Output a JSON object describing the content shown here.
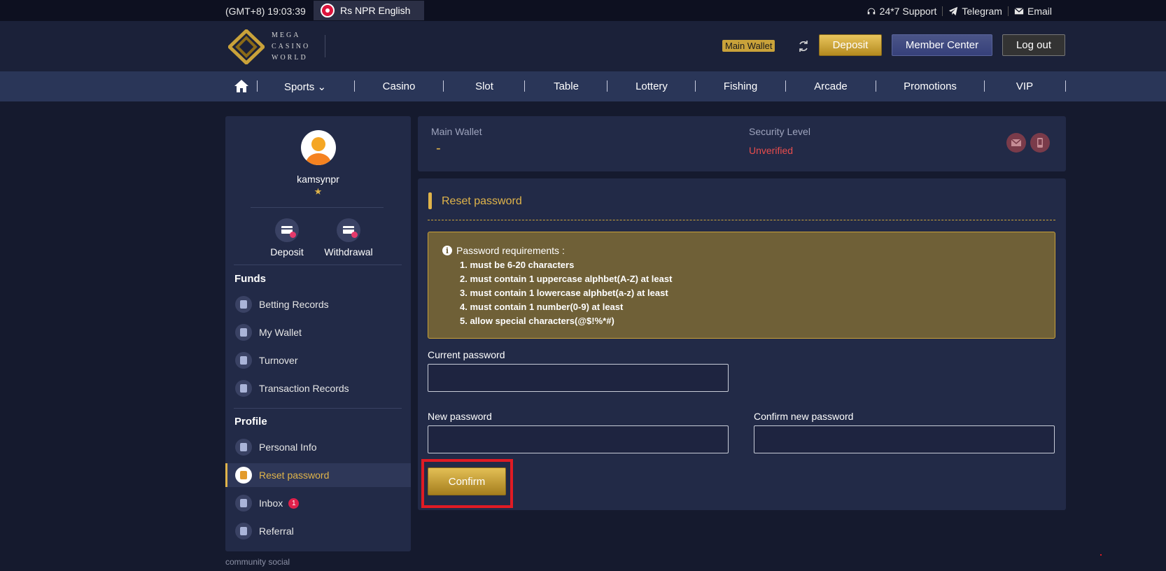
{
  "topbar": {
    "time": "(GMT+8) 19:03:39",
    "language": "Rs NPR English",
    "links": [
      {
        "label": "24*7 Support",
        "icon": "headset-icon"
      },
      {
        "label": "Telegram",
        "icon": "telegram-icon"
      },
      {
        "label": "Email",
        "icon": "email-icon"
      }
    ]
  },
  "header": {
    "logo_lines": [
      "MEGA",
      "CASINO",
      "WORLD"
    ],
    "wallet_badge": "Main Wallet",
    "deposit_label": "Deposit",
    "member_center_label": "Member Center",
    "logout_label": "Log out"
  },
  "nav": {
    "items": [
      "Sports",
      "Casino",
      "Slot",
      "Table",
      "Lottery",
      "Fishing",
      "Arcade",
      "Promotions",
      "VIP"
    ]
  },
  "sidebar": {
    "username": "kamsynpr",
    "star": "★",
    "quick": [
      {
        "label": "Deposit",
        "icon": "deposit-icon"
      },
      {
        "label": "Withdrawal",
        "icon": "withdrawal-icon"
      }
    ],
    "funds_title": "Funds",
    "funds_items": [
      "Betting Records",
      "My Wallet",
      "Turnover",
      "Transaction Records"
    ],
    "profile_title": "Profile",
    "profile_items": [
      "Personal Info",
      "Reset password",
      "Inbox",
      "Referral"
    ],
    "inbox_badge": "1",
    "footer": "community social"
  },
  "wallet": {
    "main_wallet_label": "Main Wallet",
    "main_wallet_value": "-",
    "security_label": "Security Level",
    "security_value": "Unverified"
  },
  "reset": {
    "title": "Reset password",
    "requirements_title": "Password requirements :",
    "requirements": [
      "1. must be 6-20 characters",
      "2. must contain 1 uppercase alphbet(A-Z) at least",
      "3. must contain 1 lowercase alphbet(a-z) at least",
      "4. must contain 1 number(0-9) at least",
      "5. allow special characters(@$!%*#)"
    ],
    "current_label": "Current password",
    "new_label": "New password",
    "confirm_new_label": "Confirm new password",
    "current_value": "",
    "new_value": "",
    "confirm_new_value": "",
    "confirm_button": "Confirm"
  },
  "colors": {
    "accent_gold": "#e0b44a",
    "background": "#151a2e",
    "panel": "#222a47",
    "highlight_red": "#e01b24",
    "unverified": "#e84d4d"
  }
}
